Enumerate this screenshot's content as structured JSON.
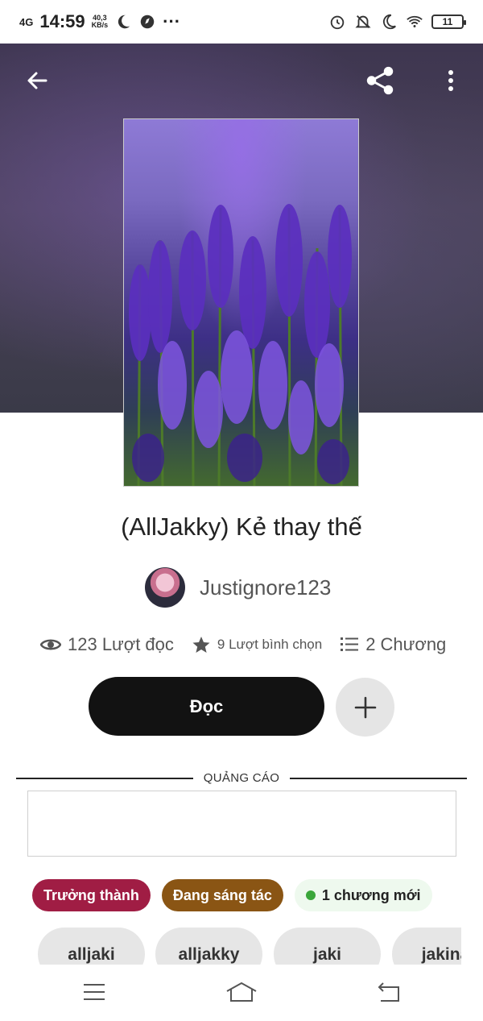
{
  "status_bar": {
    "network": "4G",
    "time": "14:59",
    "speed_value": "40,3",
    "speed_unit": "KB/s",
    "battery": "11"
  },
  "hero": {
    "cover_description": "lavender-field-cover"
  },
  "story": {
    "title": "(AllJakky) Kẻ thay thế",
    "author": "Justignore123"
  },
  "stats": {
    "views": "123 Lượt đọc",
    "votes": "9 Lượt bình chọn",
    "parts": "2 Chương"
  },
  "actions": {
    "read_label": "Đọc"
  },
  "ad": {
    "label": "QUẢNG CÁO"
  },
  "tags": {
    "mature": "Trưởng thành",
    "ongoing": "Đang sáng tác",
    "new_parts": "1 chương mới"
  },
  "keyword_chips": [
    "alljaki",
    "alljakky",
    "jaki",
    "jakina"
  ],
  "colors": {
    "read_button": "#121212",
    "mature_tag": "#a01d44",
    "ongoing_tag": "#8a5514",
    "new_dot": "#3aa63a"
  }
}
